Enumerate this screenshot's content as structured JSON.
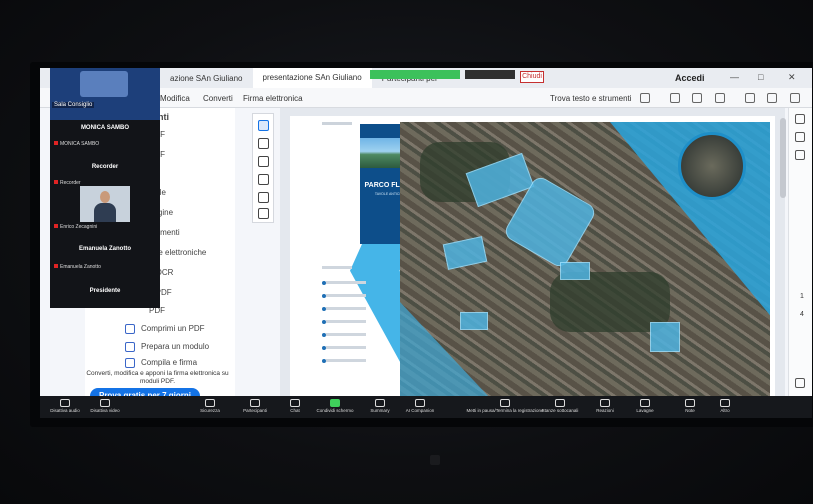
{
  "window": {
    "tabs": [
      "azione SAn Giuliano",
      "presentazione SAn Giuliano",
      "Partecipanti per"
    ],
    "stop_label": "Chiudi",
    "login_label": "Accedi",
    "controls": [
      "—",
      "□",
      "✕"
    ]
  },
  "menubar": {
    "items": [
      "Modifica",
      "Converti",
      "Firma elettronica"
    ],
    "find_label": "Trova testo e strumenti"
  },
  "tools_panel": {
    "header": "menti",
    "items": [
      "PDF",
      "PDF",
      "DF",
      "e file",
      "pagine",
      "ommenti",
      "rme elettroniche",
      "e OCR",
      "n PDF",
      "PDF",
      "Comprimi un PDF",
      "Prepara un modulo",
      "Compila e firma"
    ],
    "promo_text": "Converti, modifica e apponi la firma elettronica su moduli PDF.",
    "trial_button": "Prova gratis per 7 giorni"
  },
  "zoom_participants": {
    "badge": "Sala Consiglio",
    "participants": [
      {
        "label": "MONICA SAMBO",
        "small": "MONICA SAMBO"
      },
      {
        "label": "Recorder",
        "small": "Recorder"
      },
      {
        "label": "",
        "small": "Enrico Zecagnini"
      },
      {
        "label": "Emanuela Zanotto",
        "small": "Emanuela Zanotto"
      },
      {
        "label": "Presidente",
        "small": ""
      }
    ]
  },
  "document": {
    "cover_title": "PARCO FLUVIALE",
    "cover_subtitle": "TAVOLE ANTICIPATRICE"
  },
  "right_rail": {
    "page_numbers": [
      "1",
      "4"
    ]
  },
  "zoom_bar": {
    "buttons": [
      {
        "icon": "mic-icon",
        "label": "Disattiva audio"
      },
      {
        "icon": "video-icon",
        "label": "Disattiva video"
      },
      {
        "icon": "shield-icon",
        "label": "Sicurezza"
      },
      {
        "icon": "participants-icon",
        "label": "Partecipanti"
      },
      {
        "icon": "chat-icon",
        "label": "Chat"
      },
      {
        "icon": "share-icon",
        "label": "Condividi schermo"
      },
      {
        "icon": "summary-icon",
        "label": "Summary"
      },
      {
        "icon": "ai-companion-icon",
        "label": "AI Companion"
      },
      {
        "icon": "record-icon",
        "label": "Metti in pausa/Termina la registrazione"
      },
      {
        "icon": "rooms-icon",
        "label": "Stanze sottocanali"
      },
      {
        "icon": "reactions-icon",
        "label": "Reazioni"
      },
      {
        "icon": "apps-icon",
        "label": "Lavagne"
      },
      {
        "icon": "notes-icon",
        "label": "Note"
      },
      {
        "icon": "more-icon",
        "label": "Altro"
      }
    ]
  },
  "colors": {
    "zoom_green": "#3cc15b",
    "acrobat_blue": "#1473e6",
    "park_blue": "#4fb3e0",
    "cover_navy": "#0d4e8a"
  }
}
